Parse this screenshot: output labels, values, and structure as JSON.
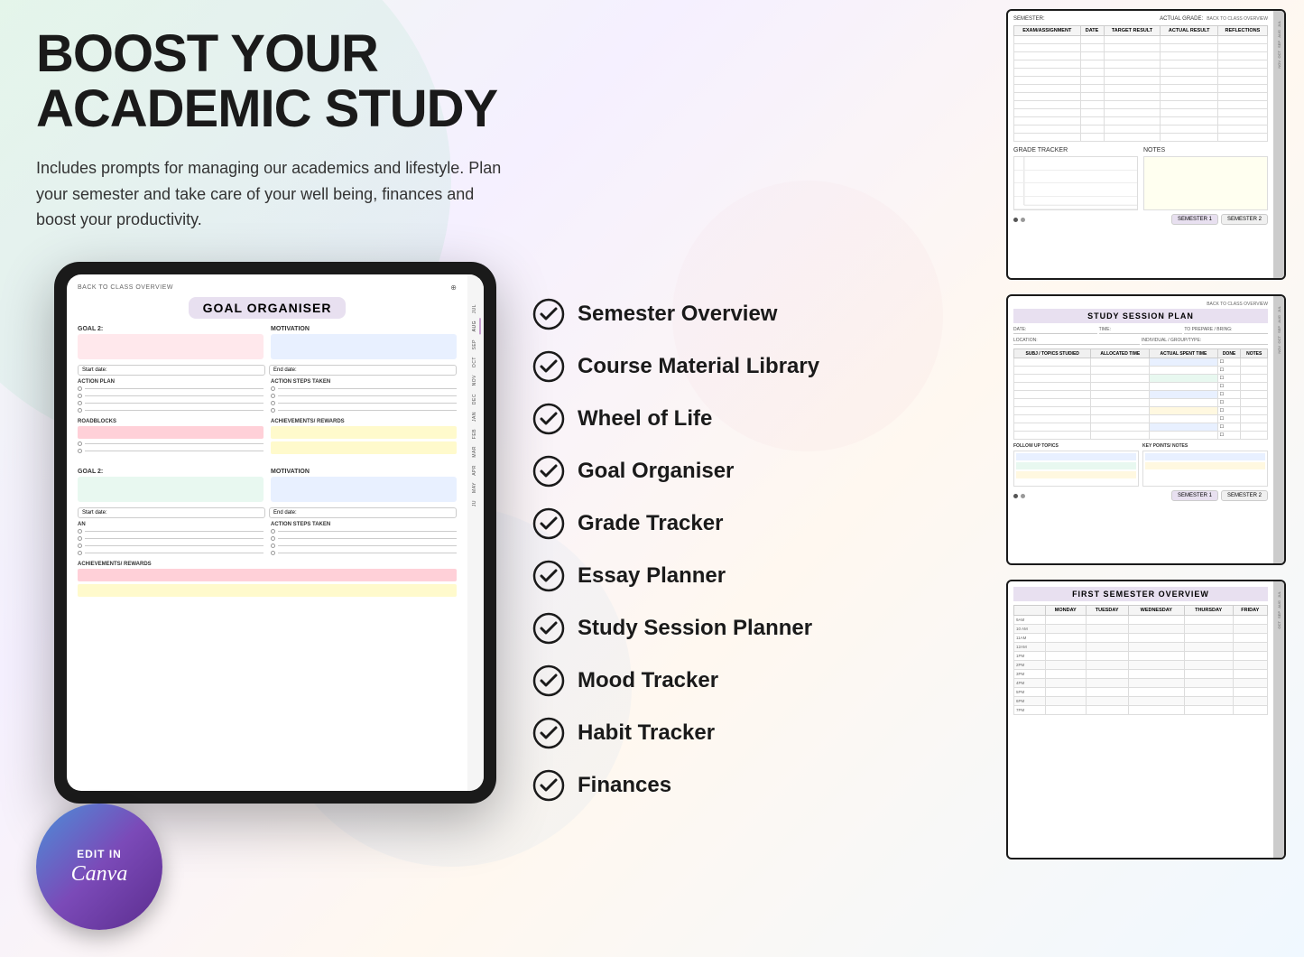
{
  "page": {
    "headline": "BOOST YOUR ACADEMIC STUDY",
    "subtitle": "Includes prompts for managing our academics and lifestyle. Plan your semester and take care of your well being, finances and boost your productivity.",
    "background": "#f5f0ee"
  },
  "tablet": {
    "back_label": "BACK TO CLASS OVERVIEW",
    "title": "GOAL ORGANISER",
    "goal1_label": "GOAL 2:",
    "motivation_label": "MOTIVATION",
    "start_date": "Start date:",
    "end_date": "End date:",
    "action_plan_label": "ACTION PLAN",
    "action_steps_label": "ACTION STEPS TAKEN",
    "roadblocks_label": "ROADBLOCKS",
    "achievements_label": "ACHIEVEMENTS/ REWARDS",
    "goal2_label": "GOAL 2:",
    "motivation2_label": "MOTIVATION",
    "months": [
      "JUL",
      "AUG",
      "SEP",
      "OCT",
      "NOV",
      "DEC",
      "JAN",
      "FEB",
      "MAR",
      "APR",
      "MAY",
      "JU"
    ]
  },
  "canva_badge": {
    "edit_label": "EDIT IN",
    "logo_text": "Canva"
  },
  "checklist": {
    "items": [
      {
        "id": "semester-overview",
        "label": "Semester Overview"
      },
      {
        "id": "course-material-library",
        "label": "Course Material Library"
      },
      {
        "id": "wheel-of-life",
        "label": "Wheel of Life"
      },
      {
        "id": "goal-organiser",
        "label": "Goal Organiser"
      },
      {
        "id": "grade-tracker",
        "label": "Grade Tracker"
      },
      {
        "id": "essay-planner",
        "label": "Essay Planner"
      },
      {
        "id": "study-session-planner",
        "label": "Study Session Planner"
      },
      {
        "id": "mood-tracker",
        "label": "Mood Tracker"
      },
      {
        "id": "habit-tracker",
        "label": "Habit Tracker"
      },
      {
        "id": "finances",
        "label": "Finances"
      }
    ]
  },
  "previews": {
    "grade_tracker": {
      "semester_label": "SEMESTER:",
      "actual_grade_label": "ACTUAL GRADE:",
      "back_label": "BACK TO CLASS OVERVIEW",
      "headers": [
        "EXAM/ASSIGNMENT",
        "DATE",
        "TARGET RESULT",
        "ACTUAL RESULT",
        "REFLECTIONS"
      ],
      "grade_tracker_title": "GRADE TRACKER",
      "notes_title": "NOTES",
      "tab1": "SEMESTER 1",
      "tab2": "SEMESTER 2"
    },
    "study_session": {
      "title": "STUDY SESSION PLAN",
      "back_label": "BACK TO CLASS OVERVIEW",
      "date_label": "DATE:",
      "time_label": "TIME:",
      "prepare_label": "TO PREPARE / BRING:",
      "location_label": "LOCATION:",
      "individual_label": "INDIVIDUAL / GROUP/TYPE:",
      "headers": [
        "SUBJ / TOPICS STUDIED",
        "ALLOCATED TIME",
        "ACTUAL SPENT TIME",
        "DONE",
        "NOTES"
      ],
      "follow_up_label": "FOLLOW UP TOPICS",
      "key_points_label": "KEY POINTS/ NOTES",
      "tab1": "SEMESTER 1",
      "tab2": "SEMESTER 2"
    },
    "semester_overview": {
      "title": "FIRST SEMESTER OVERVIEW",
      "headers": [
        "MONDAY",
        "TUESDAY",
        "WEDNESDAY",
        "THURSDAY",
        "FRIDAY"
      ],
      "times": [
        "9AM",
        "10 AM",
        "11AM",
        "12AM",
        "1PM",
        "2PM",
        "3PM",
        "4PM",
        "5PM",
        "6PM",
        "7PM"
      ]
    }
  }
}
